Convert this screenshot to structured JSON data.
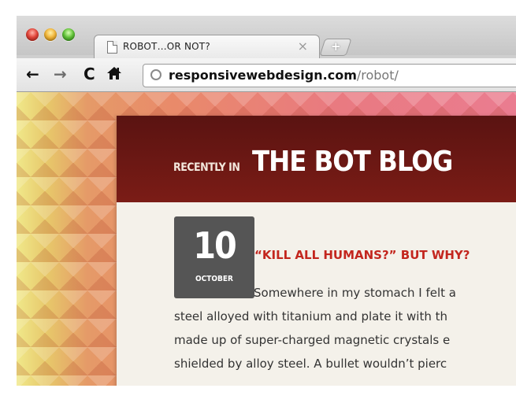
{
  "browser": {
    "tab": {
      "title": "ROBOT…OR NOT?",
      "close_label": "×"
    },
    "new_tab_label": "+",
    "toolbar": {
      "back_label": "←",
      "forward_label": "→",
      "reload_label": "C",
      "home_label": "⌂"
    },
    "address": {
      "domain": "responsivewebdesign.com",
      "path": "/robot/"
    }
  },
  "page": {
    "header_small": "RECENTLY IN",
    "header_big": "THE BOT BLOG",
    "post": {
      "day": "10",
      "month": "OCTOBER",
      "title": "“KILL ALL HUMANS?” BUT WHY?",
      "lines": [
        "Somewhere in my stomach I felt a",
        "steel alloyed with titanium and plate it with th",
        "made up of super-charged magnetic crystals e",
        "shielded by alloy steel. A bullet wouldn’t pierc"
      ]
    }
  },
  "colors": {
    "header_bg": "#6b1713",
    "title_red": "#c3261e",
    "date_box": "#555555"
  }
}
